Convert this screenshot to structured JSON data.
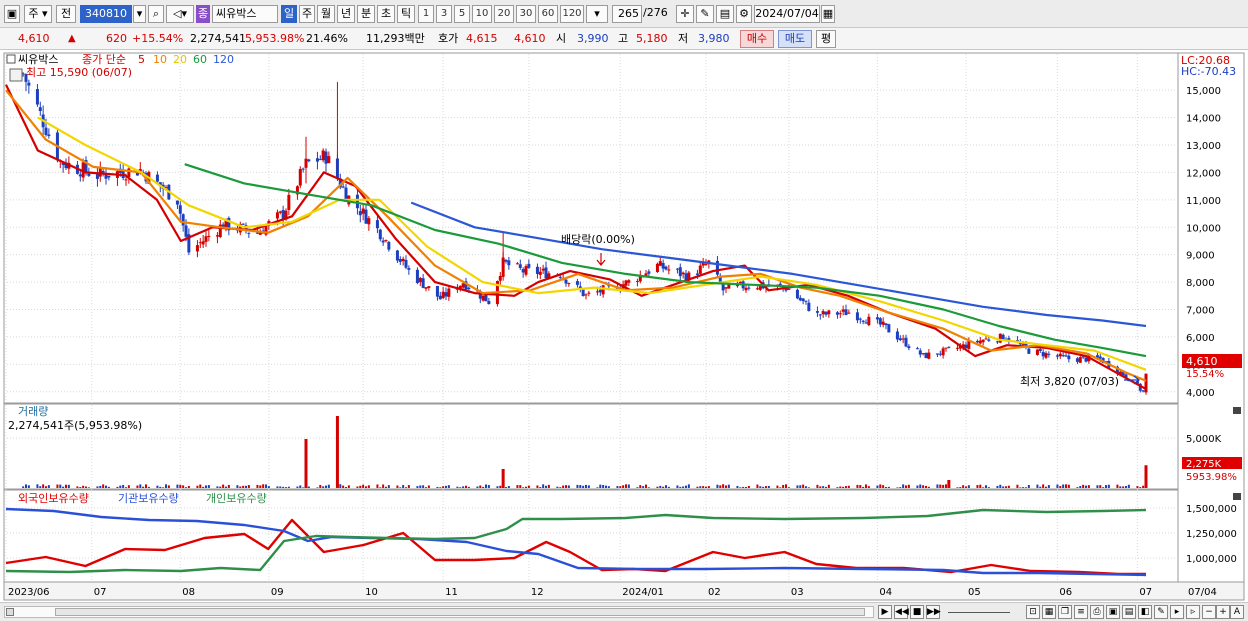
{
  "toolbar": {
    "period_label": "주",
    "market_label": "전",
    "code": "340810",
    "badge": "종",
    "stock_name": "씨유박스",
    "periods": [
      "일",
      "주",
      "월",
      "년",
      "분",
      "초",
      "틱"
    ],
    "active_period": "일",
    "intervals": [
      "1",
      "3",
      "5",
      "10",
      "20",
      "30",
      "60",
      "120"
    ],
    "count": "265",
    "count_total": "/276",
    "date": "2024/07/04"
  },
  "quote": {
    "price": "4,610",
    "arrow": "▲",
    "change": "620",
    "change_pct": "+15.54%",
    "volume": "2,274,541",
    "volume_ratio": "5,953.98%",
    "turnover": "21.46%",
    "amount": "11,293백만",
    "ask_label": "호가",
    "ask": "4,615",
    "bid": "4,610",
    "open_label": "시",
    "open": "3,990",
    "high_label": "고",
    "high": "5,180",
    "low_label": "저",
    "low": "3,980",
    "buy_label": "매수",
    "sell_label": "매도",
    "avg_label": "평"
  },
  "legend": {
    "name": "씨유박스",
    "ma_label": "종가 단순",
    "ma_periods": [
      "5",
      "10",
      "20",
      "60",
      "120"
    ],
    "high_note": "최고 15,590 (06/07)",
    "dividend_note": "배당락(0.00%)",
    "low_note": "최저 3,820 (07/03)",
    "lc": "LC:20.68",
    "hc": "HC:-70.43",
    "price_tag": "4,610",
    "pct_tag": "15.54%"
  },
  "volume_panel": {
    "title": "거래량",
    "value": "2,274,541주(5,953.98%)",
    "tag": "2,275K",
    "tag_pct": "5953.98%"
  },
  "holdings_panel": {
    "legend": [
      "외국인보유수량",
      "기관보유수량",
      "개인보유수량"
    ]
  },
  "colors": {
    "up": "#d40000",
    "down": "#1c3fbf",
    "ma5": "#d40000",
    "ma10": "#f08000",
    "ma20": "#f2d600",
    "ma60": "#1b9a3a",
    "ma120": "#2b57d6",
    "foreign": "#e00000",
    "institution": "#2b50d8",
    "individual": "#2f8f4a"
  },
  "chart_data": {
    "type": "candlestick",
    "title": "씨유박스 (340810)",
    "x_labels": [
      "2023/06",
      "07",
      "08",
      "09",
      "10",
      "11",
      "12",
      "2024/01",
      "02",
      "03",
      "04",
      "05",
      "06",
      "07",
      "07/04"
    ],
    "price_axis": {
      "ticks": [
        15000,
        14000,
        13000,
        12000,
        11000,
        10000,
        9000,
        8000,
        7000,
        6000,
        5000,
        4000
      ],
      "ylim": [
        3700,
        16100
      ]
    },
    "close_path": [
      [
        "2023-06-07",
        15590
      ],
      [
        "2023-06-20",
        12400
      ],
      [
        "2023-07-03",
        11900
      ],
      [
        "2023-07-18",
        12100
      ],
      [
        "2023-07-31",
        11000
      ],
      [
        "2023-08-04",
        9100
      ],
      [
        "2023-08-16",
        10100
      ],
      [
        "2023-08-28",
        9800
      ],
      [
        "2023-09-06",
        10500
      ],
      [
        "2023-09-14",
        12300
      ],
      [
        "2023-09-21",
        12600
      ],
      [
        "2023-09-28",
        11200
      ],
      [
        "2023-10-10",
        9800
      ],
      [
        "2023-10-20",
        8400
      ],
      [
        "2023-10-31",
        7400
      ],
      [
        "2023-11-08",
        8000
      ],
      [
        "2023-11-17",
        7300
      ],
      [
        "2023-11-22",
        8700
      ],
      [
        "2023-11-29",
        8400
      ],
      [
        "2023-12-12",
        8300
      ],
      [
        "2023-12-21",
        7500
      ],
      [
        "2024-01-05",
        8000
      ],
      [
        "2024-01-15",
        8600
      ],
      [
        "2024-01-26",
        8200
      ],
      [
        "2024-02-02",
        8700
      ],
      [
        "2024-02-07",
        7700
      ],
      [
        "2024-02-16",
        7900
      ],
      [
        "2024-02-29",
        7800
      ],
      [
        "2024-03-11",
        6800
      ],
      [
        "2024-03-22",
        6900
      ],
      [
        "2024-04-03",
        6400
      ],
      [
        "2024-04-17",
        5300
      ],
      [
        "2024-04-26",
        5500
      ],
      [
        "2024-05-08",
        5900
      ],
      [
        "2024-05-16",
        6000
      ],
      [
        "2024-05-24",
        5500
      ],
      [
        "2024-06-07",
        5200
      ],
      [
        "2024-06-18",
        5200
      ],
      [
        "2024-06-28",
        4500
      ],
      [
        "2024-07-03",
        3990
      ],
      [
        "2024-07-04",
        4610
      ]
    ],
    "series": [
      {
        "name": "5",
        "values": [
          [
            0,
            15200
          ],
          [
            8,
            12800
          ],
          [
            20,
            12000
          ],
          [
            30,
            11900
          ],
          [
            38,
            11000
          ],
          [
            44,
            9500
          ],
          [
            52,
            10000
          ],
          [
            62,
            9900
          ],
          [
            72,
            10400
          ],
          [
            80,
            12000
          ],
          [
            88,
            11500
          ],
          [
            98,
            9600
          ],
          [
            108,
            8000
          ],
          [
            118,
            7600
          ],
          [
            128,
            7500
          ],
          [
            134,
            8000
          ],
          [
            142,
            8400
          ],
          [
            152,
            8100
          ],
          [
            160,
            7500
          ],
          [
            170,
            8000
          ],
          [
            178,
            8400
          ],
          [
            186,
            8600
          ],
          [
            192,
            7700
          ],
          [
            202,
            7900
          ],
          [
            212,
            7500
          ],
          [
            222,
            6900
          ],
          [
            234,
            6300
          ],
          [
            244,
            5300
          ],
          [
            252,
            5700
          ],
          [
            262,
            5600
          ],
          [
            272,
            5300
          ],
          [
            282,
            4500
          ],
          [
            287,
            4100
          ]
        ]
      },
      {
        "name": "10",
        "values": [
          [
            0,
            15000
          ],
          [
            10,
            13200
          ],
          [
            22,
            12200
          ],
          [
            34,
            12000
          ],
          [
            44,
            10200
          ],
          [
            54,
            10000
          ],
          [
            66,
            9800
          ],
          [
            76,
            10400
          ],
          [
            86,
            11800
          ],
          [
            96,
            10400
          ],
          [
            108,
            8600
          ],
          [
            120,
            7600
          ],
          [
            132,
            7700
          ],
          [
            144,
            8300
          ],
          [
            156,
            7700
          ],
          [
            168,
            7800
          ],
          [
            180,
            8200
          ],
          [
            190,
            8300
          ],
          [
            200,
            7800
          ],
          [
            210,
            7500
          ],
          [
            222,
            6900
          ],
          [
            236,
            6300
          ],
          [
            248,
            5500
          ],
          [
            260,
            5700
          ],
          [
            272,
            5400
          ],
          [
            282,
            4700
          ],
          [
            287,
            4400
          ]
        ]
      },
      {
        "name": "20",
        "values": [
          [
            8,
            14000
          ],
          [
            20,
            13000
          ],
          [
            34,
            12000
          ],
          [
            46,
            10800
          ],
          [
            60,
            10000
          ],
          [
            72,
            10200
          ],
          [
            84,
            11000
          ],
          [
            94,
            11000
          ],
          [
            106,
            9300
          ],
          [
            120,
            8000
          ],
          [
            134,
            7600
          ],
          [
            148,
            7800
          ],
          [
            162,
            7600
          ],
          [
            176,
            7900
          ],
          [
            190,
            8200
          ],
          [
            204,
            7900
          ],
          [
            220,
            7300
          ],
          [
            236,
            6600
          ],
          [
            250,
            5900
          ],
          [
            262,
            5700
          ],
          [
            274,
            5500
          ],
          [
            287,
            4800
          ]
        ]
      },
      {
        "name": "60",
        "values": [
          [
            45,
            12300
          ],
          [
            60,
            11600
          ],
          [
            76,
            11200
          ],
          [
            92,
            10800
          ],
          [
            108,
            9900
          ],
          [
            124,
            9400
          ],
          [
            140,
            8700
          ],
          [
            156,
            8300
          ],
          [
            172,
            8000
          ],
          [
            188,
            7900
          ],
          [
            204,
            7800
          ],
          [
            220,
            7500
          ],
          [
            236,
            7000
          ],
          [
            250,
            6400
          ],
          [
            264,
            5900
          ],
          [
            276,
            5600
          ],
          [
            287,
            5300
          ]
        ]
      },
      {
        "name": "120",
        "values": [
          [
            102,
            10900
          ],
          [
            118,
            10000
          ],
          [
            134,
            9600
          ],
          [
            150,
            9200
          ],
          [
            166,
            8900
          ],
          [
            182,
            8600
          ],
          [
            198,
            8300
          ],
          [
            214,
            7900
          ],
          [
            230,
            7500
          ],
          [
            246,
            7100
          ],
          [
            262,
            6800
          ],
          [
            276,
            6600
          ],
          [
            287,
            6400
          ]
        ]
      }
    ],
    "volume_axis": {
      "ticks": [
        "5,000K"
      ],
      "spikes": [
        [
          "2023-09-14",
          4900000
        ],
        [
          "2023-09-25",
          7200000
        ],
        [
          "2023-11-22",
          1900000
        ],
        [
          "2024-04-26",
          800000
        ],
        [
          "2024-07-04",
          2275000
        ]
      ]
    },
    "holdings_axis": {
      "ticks": [
        "1,500,000",
        "1,250,000",
        "1,000,000"
      ]
    },
    "holdings_series": [
      {
        "name": "외국인보유수량",
        "values": [
          [
            0,
            950000
          ],
          [
            10,
            1010000
          ],
          [
            20,
            920000
          ],
          [
            30,
            1090000
          ],
          [
            40,
            1080000
          ],
          [
            50,
            1200000
          ],
          [
            60,
            1240000
          ],
          [
            66,
            1090000
          ],
          [
            72,
            1380000
          ],
          [
            80,
            1060000
          ],
          [
            90,
            1130000
          ],
          [
            100,
            1250000
          ],
          [
            108,
            980000
          ],
          [
            118,
            980000
          ],
          [
            128,
            1000000
          ],
          [
            136,
            1160000
          ],
          [
            142,
            1060000
          ],
          [
            150,
            880000
          ],
          [
            158,
            890000
          ],
          [
            166,
            870000
          ],
          [
            178,
            1060000
          ],
          [
            186,
            1000000
          ],
          [
            196,
            1060000
          ],
          [
            204,
            940000
          ],
          [
            214,
            900000
          ],
          [
            226,
            900000
          ],
          [
            238,
            860000
          ],
          [
            248,
            930000
          ],
          [
            258,
            870000
          ],
          [
            270,
            860000
          ],
          [
            280,
            840000
          ],
          [
            287,
            840000
          ]
        ]
      },
      {
        "name": "기관보유수량",
        "values": [
          [
            0,
            1490000
          ],
          [
            12,
            1470000
          ],
          [
            24,
            1410000
          ],
          [
            36,
            1380000
          ],
          [
            48,
            1370000
          ],
          [
            60,
            1330000
          ],
          [
            70,
            1270000
          ],
          [
            76,
            1170000
          ],
          [
            82,
            1210000
          ],
          [
            92,
            1200000
          ],
          [
            104,
            1190000
          ],
          [
            116,
            1160000
          ],
          [
            126,
            1070000
          ],
          [
            134,
            1040000
          ],
          [
            144,
            900000
          ],
          [
            160,
            890000
          ],
          [
            176,
            890000
          ],
          [
            196,
            900000
          ],
          [
            216,
            890000
          ],
          [
            236,
            880000
          ],
          [
            246,
            850000
          ],
          [
            260,
            850000
          ],
          [
            274,
            840000
          ],
          [
            287,
            830000
          ]
        ]
      },
      {
        "name": "개인보유수량",
        "values": [
          [
            0,
            870000
          ],
          [
            16,
            860000
          ],
          [
            30,
            880000
          ],
          [
            44,
            870000
          ],
          [
            54,
            900000
          ],
          [
            64,
            880000
          ],
          [
            70,
            1170000
          ],
          [
            78,
            1220000
          ],
          [
            86,
            1210000
          ],
          [
            96,
            1200000
          ],
          [
            108,
            1190000
          ],
          [
            118,
            1200000
          ],
          [
            126,
            1290000
          ],
          [
            130,
            1390000
          ],
          [
            140,
            1390000
          ],
          [
            156,
            1400000
          ],
          [
            166,
            1430000
          ],
          [
            178,
            1400000
          ],
          [
            196,
            1390000
          ],
          [
            216,
            1400000
          ],
          [
            232,
            1420000
          ],
          [
            246,
            1480000
          ],
          [
            262,
            1460000
          ],
          [
            276,
            1470000
          ],
          [
            287,
            1480000
          ]
        ]
      }
    ]
  }
}
